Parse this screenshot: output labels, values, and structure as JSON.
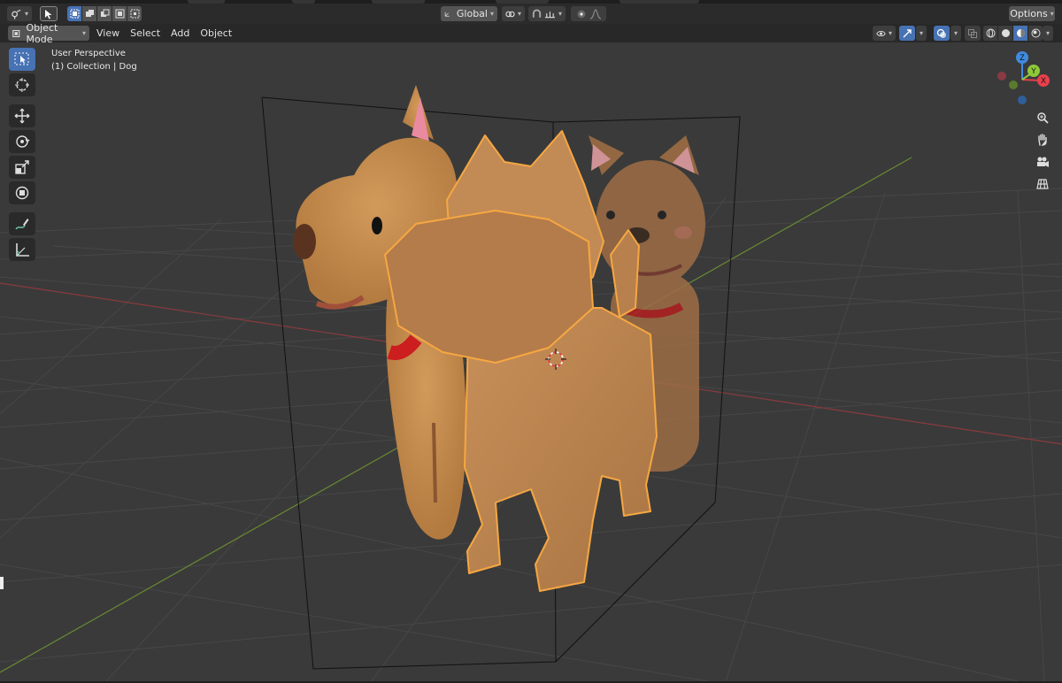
{
  "toolbar": {
    "orientation_label": "Global",
    "options_label": "Options",
    "select_modes": [
      "set-selection-icon",
      "extend-selection-icon",
      "subtract-selection-icon",
      "invert-selection-icon",
      "intersect-selection-icon"
    ]
  },
  "header": {
    "mode_label": "Object Mode",
    "menus": [
      "View",
      "Select",
      "Add",
      "Object"
    ]
  },
  "viewport": {
    "perspective_label": "User Perspective",
    "collection_label": "(1) Collection | Dog",
    "gizmo": {
      "x_label": "X",
      "y_label": "Y",
      "z_label": "Z",
      "x_color": "#e8404c",
      "y_color": "#8fc93a",
      "z_color": "#3f8be0"
    }
  },
  "tools": [
    "select-box-icon",
    "cursor-icon",
    "move-icon",
    "rotate-icon",
    "scale-icon",
    "transform-icon",
    "annotate-icon",
    "measure-icon"
  ],
  "nav": [
    "zoom-icon",
    "pan-hand-icon",
    "camera-icon",
    "grid-ortho-icon"
  ],
  "colors": {
    "accent": "#4772b3",
    "selection_outline": "#f5a742",
    "dog_fur": "#c48a4e",
    "collar": "#cc1e1e"
  }
}
